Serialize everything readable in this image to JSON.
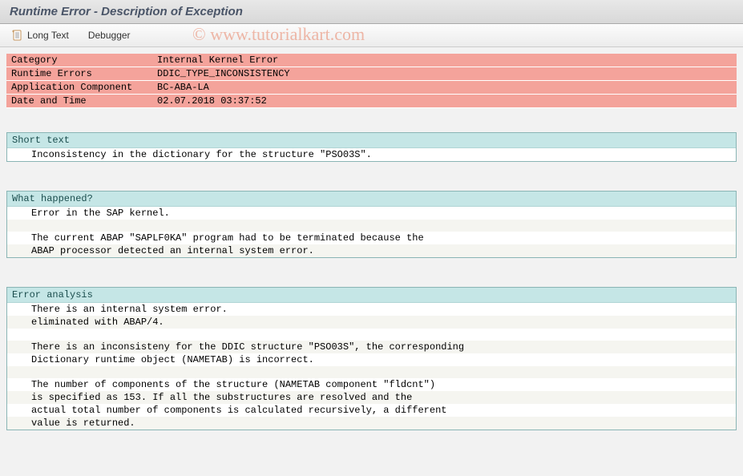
{
  "title": "Runtime Error - Description of Exception",
  "toolbar": {
    "long_text": "Long Text",
    "debugger": "Debugger"
  },
  "info": {
    "rows": [
      {
        "label": "Category",
        "value": "Internal Kernel Error"
      },
      {
        "label": "Runtime Errors",
        "value": "DDIC_TYPE_INCONSISTENCY"
      },
      {
        "label": "Application Component",
        "value": "BC-ABA-LA"
      },
      {
        "label": "Date and Time",
        "value": "02.07.2018 03:37:52"
      }
    ]
  },
  "sections": {
    "short_text": {
      "header": "Short text",
      "lines": [
        "Inconsistency in the dictionary for the structure \"PSO03S\"."
      ]
    },
    "what_happened": {
      "header": "What happened?",
      "lines": [
        "Error in the SAP kernel.",
        "",
        "The current ABAP \"SAPLF0KA\" program had to be terminated because the",
        "ABAP processor detected an internal system error."
      ]
    },
    "error_analysis": {
      "header": "Error analysis",
      "lines": [
        "There is an internal system error.",
        "eliminated with ABAP/4.",
        "",
        "There is an inconsisteny for the DDIC structure \"PSO03S\", the corresponding",
        "Dictionary runtime object (NAMETAB) is incorrect.",
        "",
        "The number of components of the structure (NAMETAB component \"fldcnt\")",
        "is specified as 153. If all the substructures are resolved and the",
        "actual total number of components is calculated recursively, a different",
        "value is returned."
      ]
    }
  },
  "watermark": "© www.tutorialkart.com"
}
